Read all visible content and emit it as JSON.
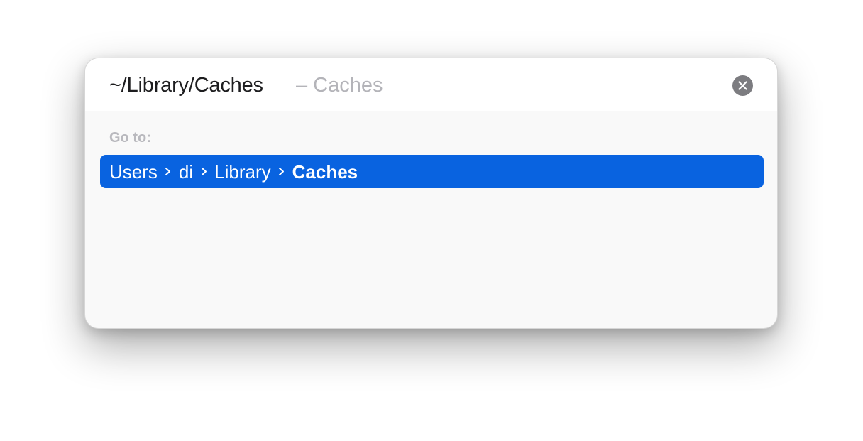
{
  "search": {
    "path_value": "~/Library/Caches",
    "hint": "– Caches"
  },
  "icons": {
    "clear": "close-circle-icon",
    "separator": "chevron-right-icon"
  },
  "results": {
    "section_label": "Go to:",
    "selected_row": {
      "crumbs": [
        "Users",
        "di",
        "Library",
        "Caches"
      ]
    }
  },
  "colors": {
    "selection": "#0963e0",
    "hint_text": "#b4b4b9",
    "clear_button": "#7c7c80"
  }
}
